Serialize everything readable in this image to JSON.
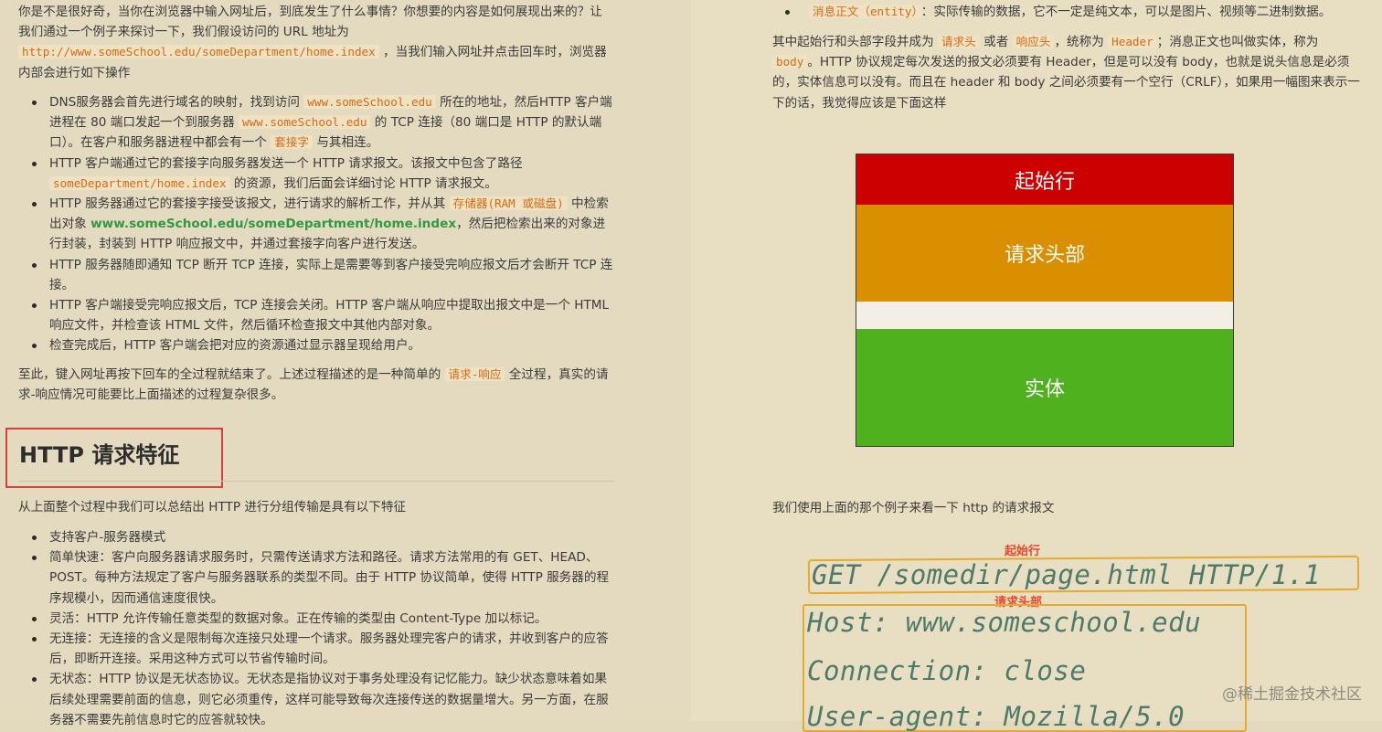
{
  "left": {
    "intro": {
      "text1": "你是不是很好奇，当你在浏览器中输入网址后，到底发生了什么事情？你想要的内容是如何展现出来的？让我们通过一个例子来探讨一下，我们假设访问的 URL 地址为",
      "url": "http://www.someSchool.edu/someDepartment/home.index",
      "text2": "，当我们输入网址并点击回车时，浏览器内部会进行如下操作"
    },
    "steps": [
      {
        "a": "DNS服务器会首先进行域名的映射，找到访问 ",
        "code1": "www.someSchool.edu",
        "b": " 所在的地址，然后HTTP 客户端进程在 80 端口发起一个到服务器 ",
        "code2": "www.someSchool.edu",
        "c": " 的 TCP 连接（80 端口是 HTTP 的默认端口）。在客户和服务器进程中都会有一个 ",
        "code3": "套接字",
        "d": " 与其相连。"
      },
      {
        "a": "HTTP 客户端通过它的套接字向服务器发送一个 HTTP 请求报文。该报文中包含了路径 ",
        "code1": "someDepartment/home.index",
        "b": " 的资源，我们后面会详细讨论 HTTP 请求报文。"
      },
      {
        "a": "HTTP 服务器通过它的套接字接受该报文，进行请求的解析工作，并从其 ",
        "code1": "存储器(RAM 或磁盘)",
        "b": " 中检索出对象 ",
        "link": "www.someSchool.edu/someDepartment/home.index",
        "c": "，然后把检索出来的对象进行封装，封装到 HTTP 响应报文中，并通过套接字向客户进行发送。"
      },
      {
        "a": "HTTP 服务器随即通知 TCP 断开 TCP 连接，实际上是需要等到客户接受完响应报文后才会断开 TCP 连接。"
      },
      {
        "a": "HTTP 客户端接受完响应报文后，TCP 连接会关闭。HTTP 客户端从响应中提取出报文中是一个 HTML 响应文件，并检查该 HTML 文件，然后循环检查报文中其他内部对象。"
      },
      {
        "a": "检查完成后，HTTP 客户端会把对应的资源通过显示器呈现给用户。"
      }
    ],
    "summary": {
      "a": "至此，键入网址再按下回车的全过程就结束了。上述过程描述的是一种简单的 ",
      "code": "请求-响应",
      "b": " 全过程，真实的请求-响应情况可能要比上面描述的过程复杂很多。"
    },
    "heading": "HTTP 请求特征",
    "features_intro": "从上面整个过程中我们可以总结出 HTTP 进行分组传输是具有以下特征",
    "features": [
      "支持客户-服务器模式",
      "简单快速：客户向服务器请求服务时，只需传送请求方法和路径。请求方法常用的有 GET、HEAD、POST。每种方法规定了客户与服务器联系的类型不同。由于 HTTP 协议简单，使得 HTTP 服务器的程序规模小，因而通信速度很快。",
      "灵活：HTTP 允许传输任意类型的数据对象。正在传输的类型由 Content-Type 加以标记。",
      "无连接：无连接的含义是限制每次连接只处理一个请求。服务器处理完客户的请求，并收到客户的应答后，即断开连接。采用这种方式可以节省传输时间。",
      "无状态：HTTP 协议是无状态协议。无状态是指协议对于事务处理没有记忆能力。缺少状态意味着如果后续处理需要前面的信息，则它必须重传，这样可能导致每次连接传送的数据量增大。另一方面，在服务器不需要先前信息时它的应答就较快。"
    ]
  },
  "right": {
    "entity_item": {
      "code": "消息正文（entity）",
      "text": "：实际传输的数据，它不一定是纯文本，可以是图片、视频等二进制数据。"
    },
    "para": {
      "a": "其中起始行和头部字段并成为 ",
      "code1": "请求头",
      "b": " 或者 ",
      "code2": "响应头",
      "c": "，统称为 ",
      "code3": "Header",
      "d": "；消息正文也叫做实体，称为 ",
      "code4": "body",
      "e": "。HTTP 协议规定每次发送的报文必须要有 Header，但是可以没有 body，也就是说头信息是必须的，实体信息可以没有。而且在 header 和 body 之间必须要有一个空行（CRLF），如果用一幅图来表示一下的话，我觉得应该是下面这样"
    },
    "diagram": {
      "start_line": "起始行",
      "headers": "请求头部",
      "blank": "",
      "entity": "实体"
    },
    "example_intro": "我们使用上面的那个例子来看一下 http 的请求报文",
    "annot_start": "起始行",
    "annot_header": "请求头部",
    "request": {
      "line": "GET /somedir/page.html HTTP/1.1",
      "host": "Host: www.someschool.edu",
      "connection": "Connection: close",
      "ua": "User-agent: Mozilla/5.0"
    },
    "watermark": "@稀土掘金技术社区",
    "colors": {
      "start": "#cc0000",
      "headers": "#d98f00",
      "blank": "#f3efe6",
      "entity": "#4fb11d",
      "annotation": "#e6a92f"
    }
  }
}
